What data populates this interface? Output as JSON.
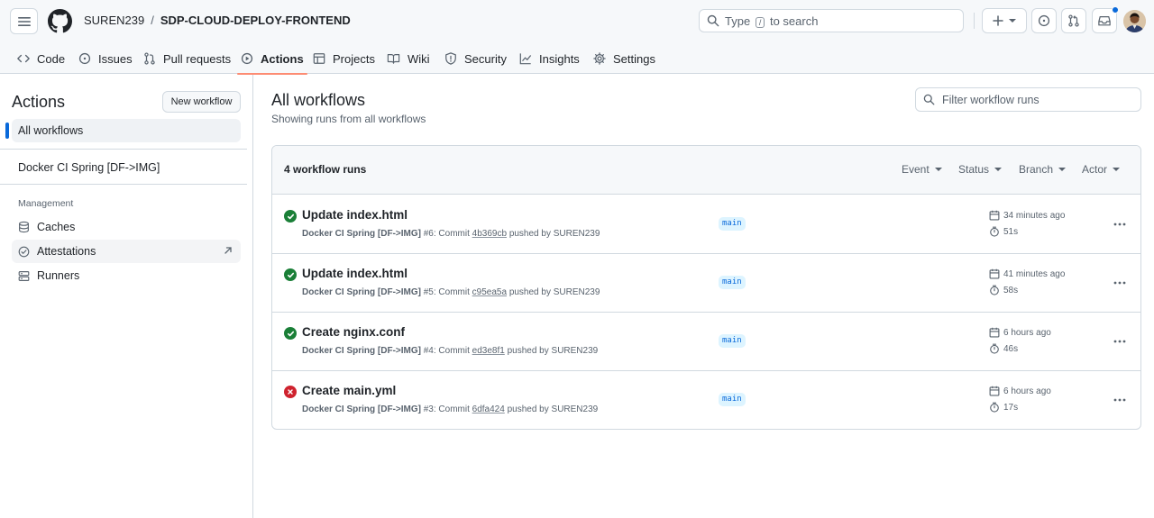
{
  "header": {
    "owner": "SUREN239",
    "separator": "/",
    "repo": "SDP-CLOUD-DEPLOY-FRONTEND",
    "search": {
      "prefix": "Type",
      "key": "/",
      "suffix": "to search"
    }
  },
  "tabs": [
    {
      "label": "Code",
      "icon": "code-icon"
    },
    {
      "label": "Issues",
      "icon": "issue-icon"
    },
    {
      "label": "Pull requests",
      "icon": "pull-request-icon"
    },
    {
      "label": "Actions",
      "icon": "play-icon",
      "active": true
    },
    {
      "label": "Projects",
      "icon": "table-icon"
    },
    {
      "label": "Wiki",
      "icon": "book-icon"
    },
    {
      "label": "Security",
      "icon": "shield-icon"
    },
    {
      "label": "Insights",
      "icon": "graph-icon"
    },
    {
      "label": "Settings",
      "icon": "gear-icon"
    }
  ],
  "sidebar": {
    "title": "Actions",
    "new_workflow": "New workflow",
    "all_workflows": "All workflows",
    "workflows": [
      "Docker CI Spring [DF->IMG]"
    ],
    "management_label": "Management",
    "management": [
      {
        "label": "Caches",
        "icon": "database-icon"
      },
      {
        "label": "Attestations",
        "icon": "check-circle-icon"
      },
      {
        "label": "Runners",
        "icon": "server-icon"
      }
    ]
  },
  "main": {
    "title": "All workflows",
    "subtitle": "Showing runs from all workflows",
    "filter_placeholder": "Filter workflow runs",
    "runs_count": "4 workflow runs",
    "filters": [
      "Event",
      "Status",
      "Branch",
      "Actor"
    ]
  },
  "runs": [
    {
      "title": "Update index.html",
      "status": "success",
      "workflow": "Docker CI Spring [DF->IMG]",
      "number": "#6",
      "commit_label": "Commit",
      "sha": "4b369cb",
      "pushed_by": "pushed by SUREN239",
      "branch": "main",
      "time": "34 minutes ago",
      "duration": "51s"
    },
    {
      "title": "Update index.html",
      "status": "success",
      "workflow": "Docker CI Spring [DF->IMG]",
      "number": "#5",
      "commit_label": "Commit",
      "sha": "c95ea5a",
      "pushed_by": "pushed by SUREN239",
      "branch": "main",
      "time": "41 minutes ago",
      "duration": "58s"
    },
    {
      "title": "Create nginx.conf",
      "status": "success",
      "workflow": "Docker CI Spring [DF->IMG]",
      "number": "#4",
      "commit_label": "Commit",
      "sha": "ed3e8f1",
      "pushed_by": "pushed by SUREN239",
      "branch": "main",
      "time": "6 hours ago",
      "duration": "46s"
    },
    {
      "title": "Create main.yml",
      "status": "failure",
      "workflow": "Docker CI Spring [DF->IMG]",
      "number": "#3",
      "commit_label": "Commit",
      "sha": "6dfa424",
      "pushed_by": "pushed by SUREN239",
      "branch": "main",
      "time": "6 hours ago",
      "duration": "17s"
    }
  ],
  "colors": {
    "success": "#1a7f37",
    "failure": "#cf222e",
    "accent": "#0969da",
    "active_tab": "#fd8c73"
  }
}
